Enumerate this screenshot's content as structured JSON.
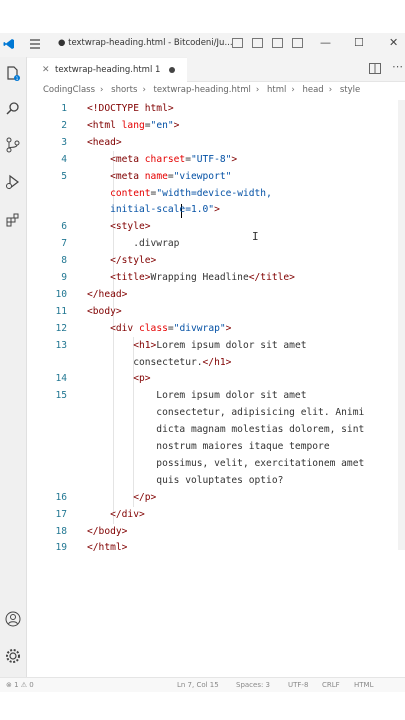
{
  "window": {
    "title": "● textwrap-heading.html - Bitcodeni/Ju...",
    "minimize": "—",
    "maximize": "☐",
    "close": "✕"
  },
  "tab": {
    "close": "✕",
    "label": "textwrap-heading.html 1"
  },
  "breadcrumb": [
    "CodingClass",
    "shorts",
    "textwrap-heading.html",
    "html",
    "head",
    "style"
  ],
  "editor": {
    "lines": [
      {
        "n": "1",
        "tokens": [
          {
            "c": "tag",
            "t": "<!DOCTYPE html>"
          }
        ]
      },
      {
        "n": "2",
        "tokens": [
          {
            "c": "tag",
            "t": "<html "
          },
          {
            "c": "attr",
            "t": "lang"
          },
          {
            "c": "",
            "t": "="
          },
          {
            "c": "val",
            "t": "\"en\""
          },
          {
            "c": "tag",
            "t": ">"
          }
        ]
      },
      {
        "n": "3",
        "tokens": [
          {
            "c": "tag",
            "t": "<head>"
          }
        ]
      },
      {
        "n": "4",
        "tokens": [
          {
            "c": "",
            "t": "    "
          },
          {
            "c": "tag",
            "t": "<meta "
          },
          {
            "c": "attr",
            "t": "charset"
          },
          {
            "c": "",
            "t": "="
          },
          {
            "c": "val",
            "t": "\"UTF-8\""
          },
          {
            "c": "tag",
            "t": ">"
          }
        ]
      },
      {
        "n": "5",
        "tokens": [
          {
            "c": "",
            "t": "    "
          },
          {
            "c": "tag",
            "t": "<meta "
          },
          {
            "c": "attr",
            "t": "name"
          },
          {
            "c": "",
            "t": "="
          },
          {
            "c": "val",
            "t": "\"viewport\""
          }
        ]
      },
      {
        "n": "",
        "tokens": [
          {
            "c": "",
            "t": "    "
          },
          {
            "c": "attr",
            "t": "content"
          },
          {
            "c": "",
            "t": "="
          },
          {
            "c": "val",
            "t": "\"width=device-width,"
          }
        ]
      },
      {
        "n": "",
        "tokens": [
          {
            "c": "",
            "t": "    "
          },
          {
            "c": "val",
            "t": "initial-scale=1.0\""
          },
          {
            "c": "tag",
            "t": ">"
          }
        ]
      },
      {
        "n": "6",
        "tokens": [
          {
            "c": "",
            "t": "    "
          },
          {
            "c": "tag",
            "t": "<style>"
          }
        ]
      },
      {
        "n": "7",
        "tokens": [
          {
            "c": "",
            "t": "        .divwrap"
          }
        ]
      },
      {
        "n": "8",
        "tokens": [
          {
            "c": "",
            "t": "    "
          },
          {
            "c": "tag",
            "t": "</style>"
          }
        ]
      },
      {
        "n": "9",
        "tokens": [
          {
            "c": "",
            "t": "    "
          },
          {
            "c": "tag",
            "t": "<title>"
          },
          {
            "c": "",
            "t": "Wrapping Headline"
          },
          {
            "c": "tag",
            "t": "</title>"
          }
        ]
      },
      {
        "n": "10",
        "tokens": [
          {
            "c": "tag",
            "t": "</head>"
          }
        ]
      },
      {
        "n": "11",
        "tokens": [
          {
            "c": "tag",
            "t": "<body>"
          }
        ]
      },
      {
        "n": "12",
        "tokens": [
          {
            "c": "",
            "t": "    "
          },
          {
            "c": "tag",
            "t": "<div "
          },
          {
            "c": "attr",
            "t": "class"
          },
          {
            "c": "",
            "t": "="
          },
          {
            "c": "val",
            "t": "\"divwrap\""
          },
          {
            "c": "tag",
            "t": ">"
          }
        ]
      },
      {
        "n": "13",
        "tokens": [
          {
            "c": "",
            "t": "        "
          },
          {
            "c": "tag",
            "t": "<h1>"
          },
          {
            "c": "",
            "t": "Lorem ipsum dolor sit amet"
          }
        ]
      },
      {
        "n": "",
        "tokens": [
          {
            "c": "",
            "t": "        consectetur."
          },
          {
            "c": "tag",
            "t": "</h1>"
          }
        ]
      },
      {
        "n": "14",
        "tokens": [
          {
            "c": "",
            "t": "        "
          },
          {
            "c": "tag",
            "t": "<p>"
          }
        ]
      },
      {
        "n": "15",
        "tokens": [
          {
            "c": "",
            "t": "            Lorem ipsum dolor sit amet"
          }
        ]
      },
      {
        "n": "",
        "tokens": [
          {
            "c": "",
            "t": "            consectetur, adipisicing elit. Animi"
          }
        ]
      },
      {
        "n": "",
        "tokens": [
          {
            "c": "",
            "t": "            dicta magnam molestias dolorem, sint"
          }
        ]
      },
      {
        "n": "",
        "tokens": [
          {
            "c": "",
            "t": "            nostrum maiores itaque tempore"
          }
        ]
      },
      {
        "n": "",
        "tokens": [
          {
            "c": "",
            "t": "            possimus, velit, exercitationem amet"
          }
        ]
      },
      {
        "n": "",
        "tokens": [
          {
            "c": "",
            "t": "            quis voluptates optio?"
          }
        ]
      },
      {
        "n": "16",
        "tokens": [
          {
            "c": "",
            "t": "        "
          },
          {
            "c": "tag",
            "t": "</p>"
          }
        ]
      },
      {
        "n": "17",
        "tokens": [
          {
            "c": "",
            "t": "    "
          },
          {
            "c": "tag",
            "t": "</div>"
          }
        ]
      },
      {
        "n": "18",
        "tokens": [
          {
            "c": "tag",
            "t": "</body>"
          }
        ]
      },
      {
        "n": "19",
        "tokens": [
          {
            "c": "tag",
            "t": "</html>"
          }
        ]
      }
    ]
  },
  "statusbar": {
    "errors": "⊗ 1 ⚠ 0",
    "position": "Ln 7, Col 15",
    "spaces": "Spaces: 3",
    "encoding": "UTF-8",
    "eol": "CRLF",
    "language": "HTML"
  },
  "icons": [
    "vscode-logo-icon",
    "menu-icon",
    "explorer-icon",
    "search-icon",
    "source-control-icon",
    "run-debug-icon",
    "extensions-icon",
    "account-icon",
    "settings-gear-icon"
  ],
  "colors": {
    "tag": "#800000",
    "attribute": "#e50000",
    "value": "#0451a5",
    "line_number": "#237893"
  }
}
